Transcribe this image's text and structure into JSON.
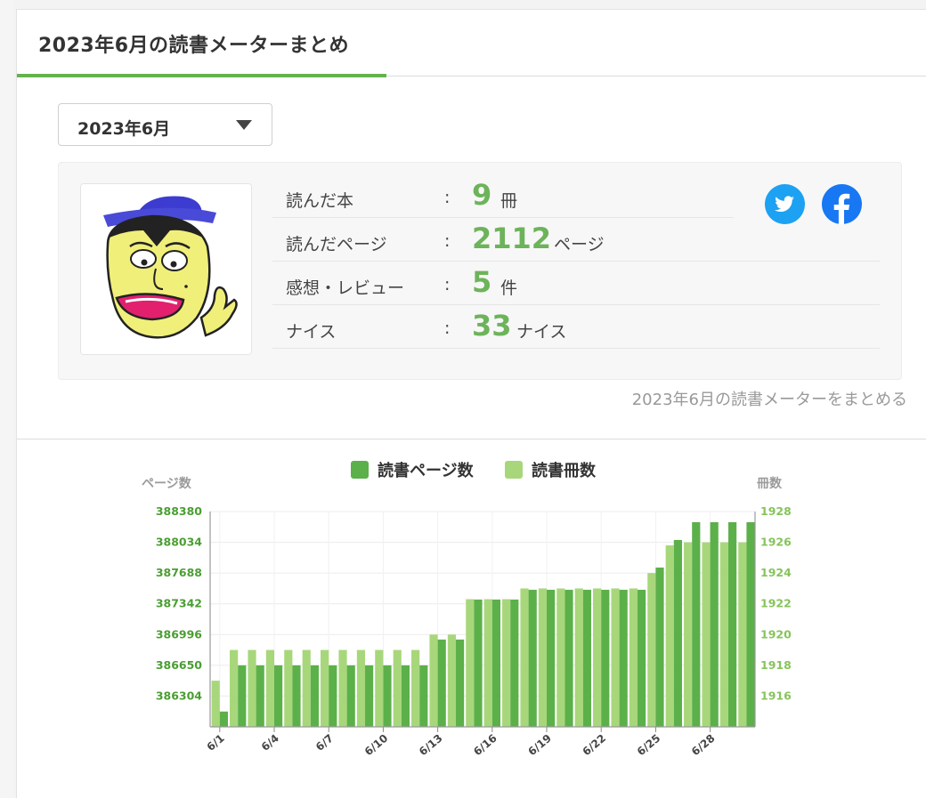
{
  "header": {
    "title": "2023年6月の読書メーターまとめ"
  },
  "month_select": {
    "value": "2023年6月"
  },
  "stats": [
    {
      "label": "読んだ本",
      "value": "9",
      "unit": "冊"
    },
    {
      "label": "読んだページ",
      "value": "2112",
      "unit": "ページ"
    },
    {
      "label": "感想・レビュー",
      "value": "5",
      "unit": "件"
    },
    {
      "label": "ナイス",
      "value": "33",
      "unit": "ナイス"
    }
  ],
  "social": {
    "twitter": "twitter-icon",
    "facebook": "facebook-icon"
  },
  "summarize_link": "2023年6月の読書メーターをまとめる",
  "colors": {
    "accent": "#64b24d",
    "pages_bar": "#5cb04a",
    "books_bar": "#a8d77b",
    "number": "#6db35a"
  },
  "chart_data": {
    "type": "bar",
    "legend": [
      "読書ページ数",
      "読書冊数"
    ],
    "legend_position": "top-center",
    "ylabel_left": "ページ数",
    "ylabel_right": "冊数",
    "yticks_left": [
      "386304",
      "386650",
      "386996",
      "387342",
      "387688",
      "388034",
      "388380"
    ],
    "yticks_right": [
      "1916",
      "1918",
      "1920",
      "1922",
      "1924",
      "1926",
      "1928"
    ],
    "ylim_left": [
      385958,
      388380
    ],
    "ylim_right": [
      1914,
      1928
    ],
    "grid": true,
    "x": [
      "6/1",
      "6/2",
      "6/3",
      "6/4",
      "6/5",
      "6/6",
      "6/7",
      "6/8",
      "6/9",
      "6/10",
      "6/11",
      "6/12",
      "6/13",
      "6/14",
      "6/15",
      "6/16",
      "6/17",
      "6/18",
      "6/19",
      "6/20",
      "6/21",
      "6/22",
      "6/23",
      "6/24",
      "6/25",
      "6/26",
      "6/27",
      "6/28",
      "6/29",
      "6/30"
    ],
    "xtick_labels": [
      "6/1",
      "6/4",
      "6/7",
      "6/10",
      "6/13",
      "6/16",
      "6/19",
      "6/22",
      "6/25",
      "6/28"
    ],
    "series": [
      {
        "name": "読書冊数",
        "axis": "right",
        "values": [
          1917,
          1919,
          1919,
          1919,
          1919,
          1919,
          1919,
          1919,
          1919,
          1919,
          1919,
          1919,
          1920,
          1920,
          1922.3,
          1922.3,
          1922.3,
          1923,
          1923,
          1923,
          1923,
          1923,
          1923,
          1923,
          1924,
          1925.8,
          1926,
          1926,
          1926,
          1926
        ]
      },
      {
        "name": "読書ページ数",
        "axis": "left",
        "values": [
          386130,
          386650,
          386650,
          386650,
          386650,
          386650,
          386650,
          386650,
          386650,
          386650,
          386650,
          386650,
          386940,
          386940,
          387390,
          387390,
          387390,
          387500,
          387500,
          387500,
          387500,
          387500,
          387500,
          387500,
          387750,
          388060,
          388260,
          388260,
          388260,
          388260
        ]
      }
    ]
  }
}
